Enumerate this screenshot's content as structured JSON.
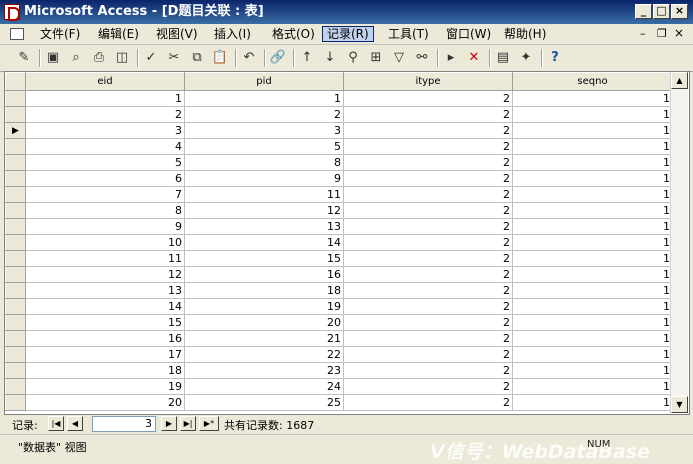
{
  "window": {
    "title": "Microsoft Access - [D题目关联 : 表]"
  },
  "menu": [
    {
      "label": "文件(F)",
      "active": false
    },
    {
      "label": "编辑(E)",
      "active": false
    },
    {
      "label": "视图(V)",
      "active": false
    },
    {
      "label": "插入(I)",
      "active": false
    },
    {
      "label": "格式(O)",
      "active": false
    },
    {
      "label": "记录(R)",
      "active": true
    },
    {
      "label": "工具(T)",
      "active": false
    },
    {
      "label": "窗口(W)",
      "active": false
    },
    {
      "label": "帮助(H)",
      "active": false
    }
  ],
  "toolbar_icons": [
    "design-view-icon",
    "save-icon",
    "search-icon",
    "print-icon",
    "print-preview-icon",
    "spell-check-icon",
    "cut-icon",
    "copy-icon",
    "paste-icon",
    "undo-icon",
    "hyperlink-icon",
    "sort-ascending-icon",
    "sort-descending-icon",
    "filter-by-selection-icon",
    "filter-by-form-icon",
    "apply-filter-icon",
    "find-icon",
    "new-record-icon",
    "delete-record-icon",
    "database-window-icon",
    "new-object-icon",
    "help-icon"
  ],
  "grid": {
    "columns": [
      "eid",
      "pid",
      "itype",
      "seqno"
    ],
    "current_row": 3,
    "rows": [
      [
        "1",
        "1",
        "2",
        "1"
      ],
      [
        "2",
        "2",
        "2",
        "1"
      ],
      [
        "3",
        "3",
        "2",
        "1"
      ],
      [
        "4",
        "5",
        "2",
        "1"
      ],
      [
        "5",
        "8",
        "2",
        "1"
      ],
      [
        "6",
        "9",
        "2",
        "1"
      ],
      [
        "7",
        "11",
        "2",
        "1"
      ],
      [
        "8",
        "12",
        "2",
        "1"
      ],
      [
        "9",
        "13",
        "2",
        "1"
      ],
      [
        "10",
        "14",
        "2",
        "1"
      ],
      [
        "11",
        "15",
        "2",
        "1"
      ],
      [
        "12",
        "16",
        "2",
        "1"
      ],
      [
        "13",
        "18",
        "2",
        "1"
      ],
      [
        "14",
        "19",
        "2",
        "1"
      ],
      [
        "15",
        "20",
        "2",
        "1"
      ],
      [
        "16",
        "21",
        "2",
        "1"
      ],
      [
        "17",
        "22",
        "2",
        "1"
      ],
      [
        "18",
        "23",
        "2",
        "1"
      ],
      [
        "19",
        "24",
        "2",
        "1"
      ],
      [
        "20",
        "25",
        "2",
        "1"
      ]
    ]
  },
  "navigation": {
    "label": "记录:",
    "current_record": "3",
    "total_label": "共有记录数: 1687"
  },
  "status": {
    "view_text": "\"数据表\" 视图",
    "indicator": "NUM",
    "watermark": "V信号：WebDataBase"
  }
}
